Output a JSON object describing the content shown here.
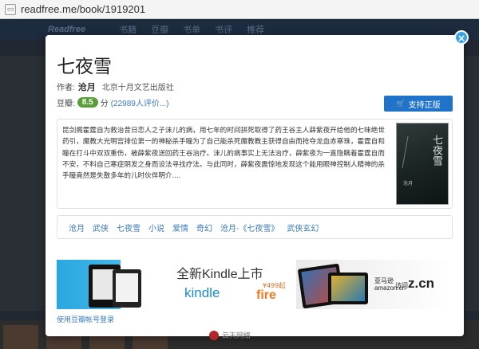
{
  "browser": {
    "url": "readfree.me/book/1919201"
  },
  "background": {
    "logo": "Readfree",
    "nav": [
      "书籍",
      "豆瓣",
      "书单",
      "书评",
      "推荐"
    ]
  },
  "modal": {
    "close_symbol": "×",
    "title": "七夜雪",
    "author_label": "作者:",
    "author": "沧月",
    "publisher": "北京十月文艺出版社",
    "rating_label": "豆瓣:",
    "score": "8.5",
    "score_unit": "分",
    "rating_count": "(22989人评价...)",
    "support_button": "支持正版",
    "description": "昆剑阁霍霆自为救治昔日恋人之子沫儿的病，用七年的时间拼死取得了药王谷主人薛紫夜开给他的七味绝世药引，魔教大光明宫排位第一的神秘杀手瞳为了自己能杀死魔教教主获得自由而抢夺龙血赤寒珠，霍霆自和瞳在打斗中双双重伤，被薛紫夜送回药王谷治疗。沫儿的病事实上无法治疗，薛紫夜为一直隐瞒着霍霆自而不安，不料自己寒症阴发之身而设法寻找疗法。与此同时，薛紫夜震惊地发现这个能用眼神控制人精神的杀手瞳竟然是失散多年的儿时伙伴明介....",
    "cover_title": "七夜雪",
    "cover_author": "沧月",
    "tags": [
      "沧月",
      "武侠",
      "七夜雪",
      "小说",
      "爱情",
      "奇幻",
      "沧月-《七夜雪》",
      "武侠玄幻"
    ],
    "ad": {
      "headline": "全新Kindle上市",
      "kindle": "kindle",
      "price": "¥499起",
      "fire": "fire",
      "amazon_line1": "亚马逊",
      "amazon_line2": "amazon.cn",
      "amazon_tail": "z.cn",
      "amazon_sep": "访问"
    },
    "login_link": "使用豆瓣帐号登录"
  },
  "watermark": {
    "text": "云天网络"
  },
  "colors": {
    "accent_blue": "#1f73c9",
    "link_blue": "#3a7ab8",
    "score_green": "#5a9e3a",
    "close_blue": "#3aa3e3"
  }
}
